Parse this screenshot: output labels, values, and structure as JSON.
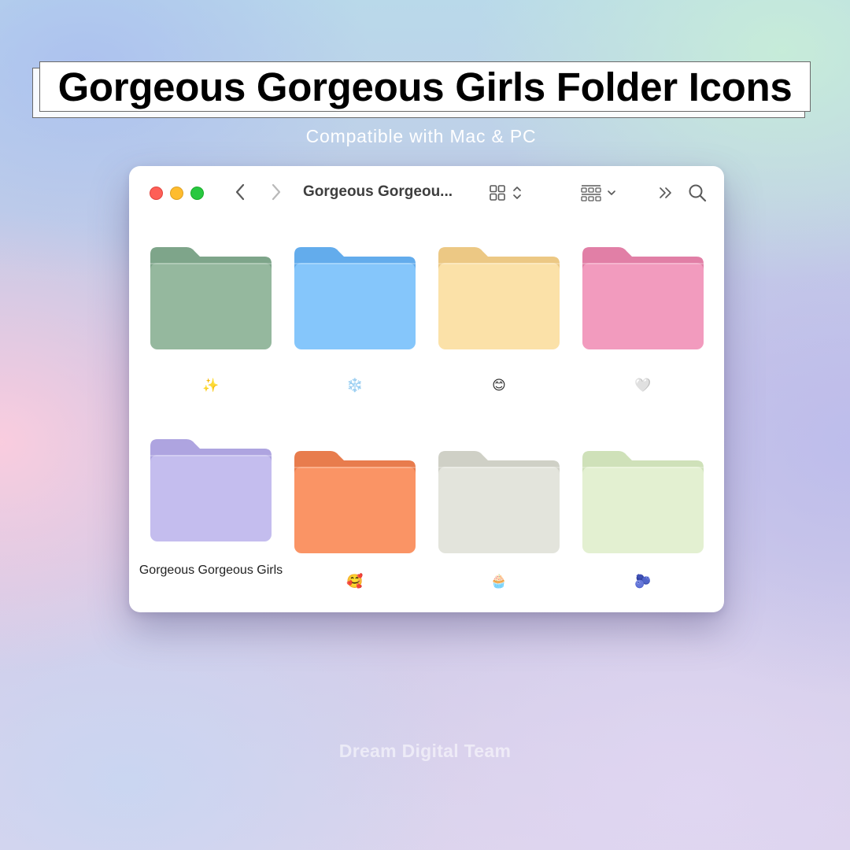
{
  "banner": {
    "title": "Gorgeous Gorgeous Girls Folder Icons",
    "subtitle": "Compatible with Mac & PC"
  },
  "window": {
    "title": "Gorgeous Gorgeou...",
    "icons": {
      "back": "chevron-left-icon",
      "forward": "chevron-right-icon",
      "view": "grid-view-icon",
      "group": "group-by-icon",
      "more": "double-chevron-icon",
      "search": "search-icon"
    }
  },
  "folders": [
    {
      "label": "✨",
      "front": "#95b89e",
      "back": "#7ea58a"
    },
    {
      "label": "❄️",
      "front": "#85c6fb",
      "back": "#63acec"
    },
    {
      "label": "😊",
      "front": "#fbe1a8",
      "back": "#ecc884"
    },
    {
      "label": "🤍",
      "front": "#f29bbe",
      "back": "#e17fa6"
    },
    {
      "label": "Gorgeous Gorgeous Girls",
      "front": "#c4bdee",
      "back": "#aea4e0"
    },
    {
      "label": "🥰",
      "front": "#fa9465",
      "back": "#e87c4d"
    },
    {
      "label": "🧁",
      "front": "#e3e4dc",
      "back": "#cfd0c6"
    },
    {
      "label": "🫐",
      "front": "#e3f0d1",
      "back": "#cfe1b9"
    }
  ],
  "watermark": "Dream Digital Team"
}
